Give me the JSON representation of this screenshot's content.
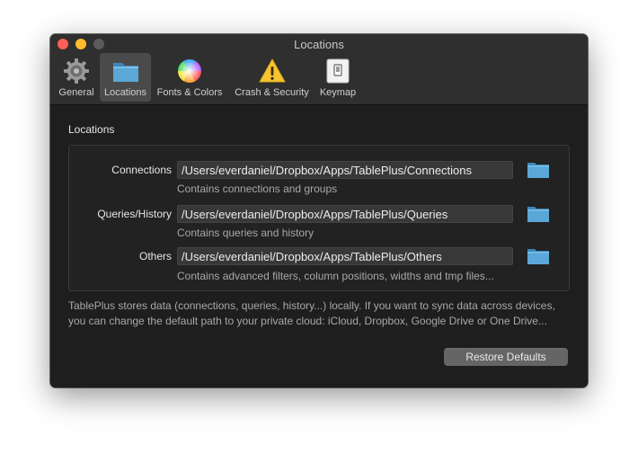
{
  "window": {
    "title": "Locations"
  },
  "toolbar": {
    "tabs": [
      {
        "label": "General",
        "icon": "gear-icon"
      },
      {
        "label": "Locations",
        "icon": "folder-icon",
        "selected": true
      },
      {
        "label": "Fonts & Colors",
        "icon": "color-wheel-icon"
      },
      {
        "label": "Crash & Security",
        "icon": "warning-icon"
      },
      {
        "label": "Keymap",
        "icon": "keymap-icon"
      }
    ]
  },
  "locations": {
    "section_title": "Locations",
    "rows": [
      {
        "label": "Connections",
        "path": "/Users/everdaniel/Dropbox/Apps/TablePlus/Connections",
        "description": "Contains connections and groups"
      },
      {
        "label": "Queries/History",
        "path": "/Users/everdaniel/Dropbox/Apps/TablePlus/Queries",
        "description": "Contains queries and history"
      },
      {
        "label": "Others",
        "path": "/Users/everdaniel/Dropbox/Apps/TablePlus/Others",
        "description": "Contains advanced filters, column positions, widths and tmp files..."
      }
    ],
    "info_text": "TablePlus stores data (connections, queries, history...) locally. If you want to sync data across devices, you can change the default path to your private cloud: iCloud, Dropbox, Google Drive or One Drive...",
    "restore_label": "Restore Defaults"
  },
  "colors": {
    "accent_folder": "#5aa7d8",
    "window_bg": "#1e1e1e",
    "toolbar_bg": "#2f2f2f"
  }
}
